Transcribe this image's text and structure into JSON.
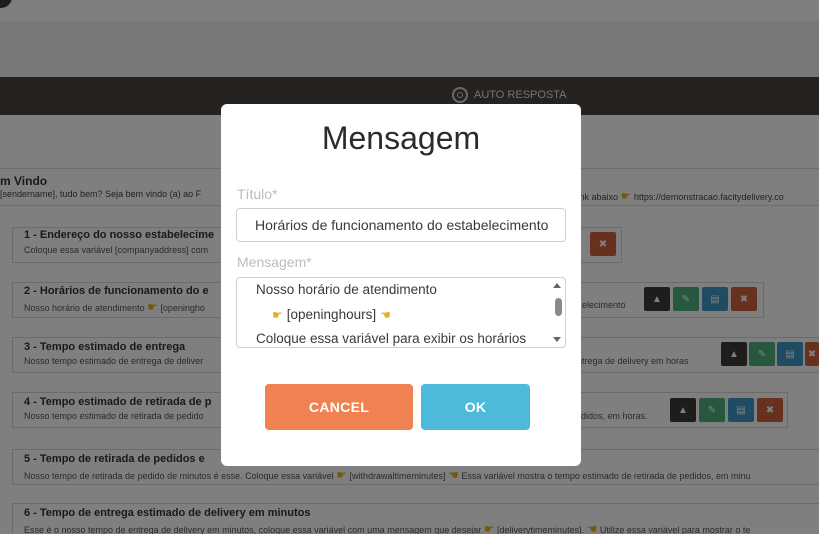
{
  "header": {
    "section_label": "AUTO RESPOSTA"
  },
  "welcome": {
    "title": "m Vindo",
    "text": "[sendername], tudo bem? Seja bem vindo (a) ao F",
    "link_text": "o link abaixo",
    "link_url": "https://demonstracao.facitydelivery.co"
  },
  "cards": [
    {
      "title": "1 - Endereço do nosso estabelecime",
      "desc": "Coloque essa variável [companyaddress] com"
    },
    {
      "title": "2 - Horários de funcionamento do e",
      "desc": "Nosso horário de atendimento",
      "desc_var": "[openingho",
      "desc_tail": "elecimento"
    },
    {
      "title": "3 - Tempo estimado de entrega",
      "desc": "Nosso tempo estimado de entrega de deliver",
      "desc_tail": "ntrega de delivery em horas"
    },
    {
      "title": "4 - Tempo estimado de retirada de p",
      "desc": "Nosso tempo estimado de retirada de pedido",
      "desc_tail": "edidos, em horas."
    },
    {
      "title": "5 - Tempo de retirada de pedidos e",
      "desc": "Nosso tempo de retirada de pedido de minutos é esse. Coloque essa variável",
      "desc_var": "[withdrawaltimeminutes]",
      "desc_tail": "Essa variável mostra o tempo estimado de retirada de pedidos, em minu"
    },
    {
      "title": "6 - Tempo de entrega estimado de delivery em minutos",
      "desc": "Esse é o nosso tempo de entrega de delivery em minutos, coloque essa variável com uma mensagem que desejar",
      "desc_var": "[deliverytimeminutes].",
      "desc_tail": "Utilize essa variável para mostrar o te"
    }
  ],
  "modal": {
    "title": "Mensagem",
    "titulo_label": "Título*",
    "titulo_value": "Horários de funcionamento do estabelecimento",
    "mensagem_label": "Mensagem*",
    "mensagem_lines": [
      "Nosso horário de atendimento",
      "[openinghours]",
      "Coloque essa variável para exibir os horários"
    ],
    "cancel_label": "CANCEL",
    "ok_label": "OK"
  },
  "colors": {
    "cancel": "#f08151",
    "ok": "#4dbadb",
    "dark_bar": "#4a4440"
  }
}
